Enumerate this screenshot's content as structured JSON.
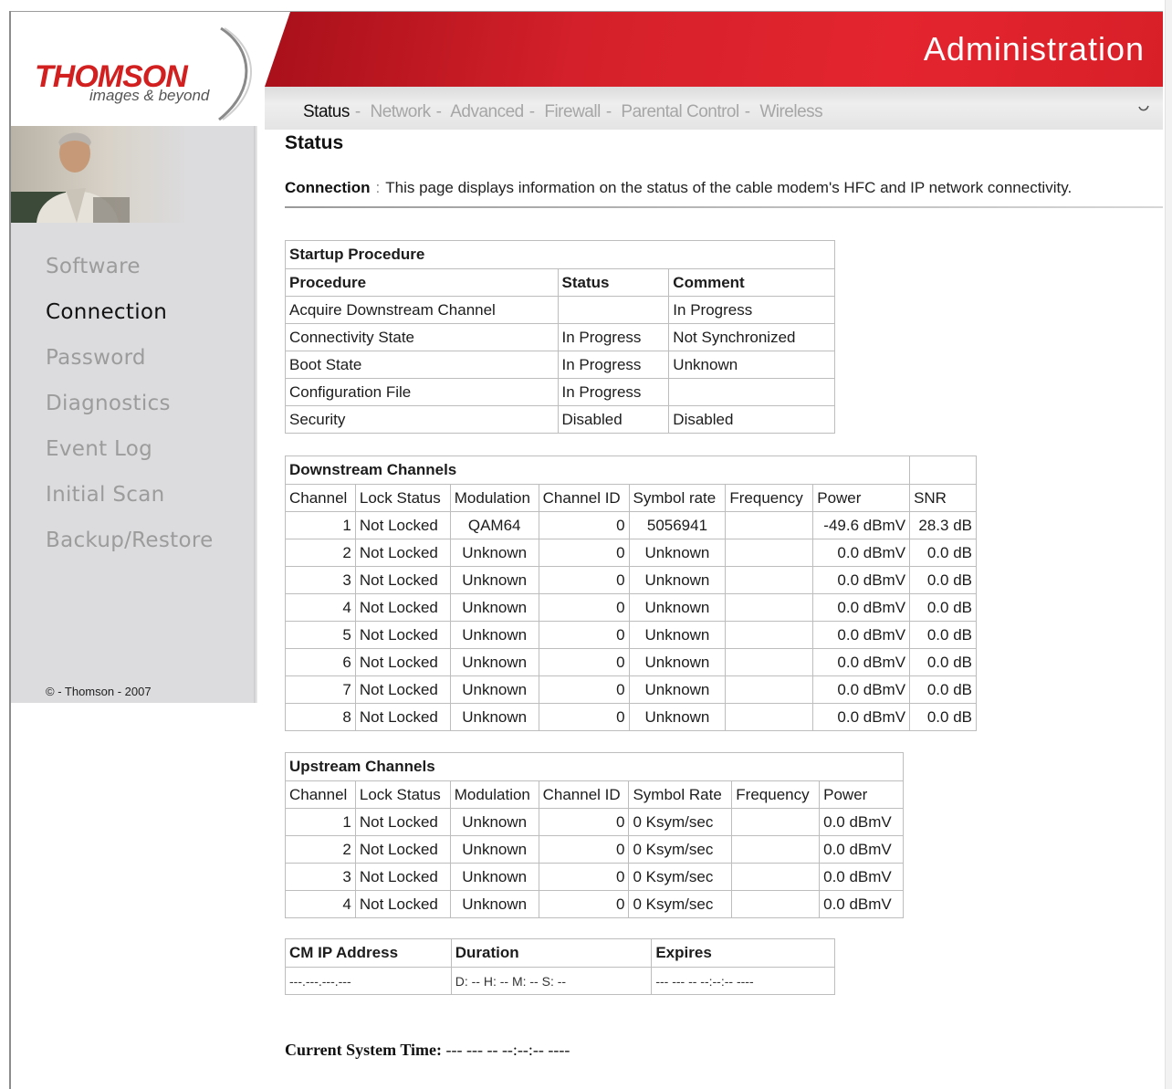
{
  "branding": {
    "logo_name": "THOMSON",
    "logo_tagline": "images & beyond",
    "banner_title": "Administration"
  },
  "top_nav": {
    "items": [
      "Status",
      "Network",
      "Advanced",
      "Firewall",
      "Parental Control",
      "Wireless"
    ],
    "active": "Status",
    "separator": "-"
  },
  "sidebar": {
    "items": [
      "Software",
      "Connection",
      "Password",
      "Diagnostics",
      "Event Log",
      "Initial Scan",
      "Backup/Restore"
    ],
    "active": "Connection",
    "copyright": "© - Thomson - 2007"
  },
  "page": {
    "heading": "Status",
    "section_label": "Connection",
    "colon": ":",
    "description": "This page displays information on the status of the cable modem's HFC and IP network connectivity."
  },
  "startup": {
    "title": "Startup Procedure",
    "headers": [
      "Procedure",
      "Status",
      "Comment"
    ],
    "rows": [
      [
        "Acquire Downstream Channel",
        "",
        "In Progress"
      ],
      [
        "Connectivity State",
        "In Progress",
        "Not Synchronized"
      ],
      [
        "Boot State",
        "In Progress",
        "Unknown"
      ],
      [
        "Configuration File",
        "In Progress",
        ""
      ],
      [
        "Security",
        "Disabled",
        "Disabled"
      ]
    ]
  },
  "downstream": {
    "title": "Downstream Channels",
    "headers": [
      "Channel",
      "Lock Status",
      "Modulation",
      "Channel ID",
      "Symbol rate",
      "Frequency",
      "Power",
      "SNR"
    ],
    "rows": [
      [
        "1",
        "Not Locked",
        "QAM64",
        "0",
        "5056941",
        "",
        "-49.6 dBmV",
        "28.3 dB"
      ],
      [
        "2",
        "Not Locked",
        "Unknown",
        "0",
        "Unknown",
        "",
        "0.0 dBmV",
        "0.0 dB"
      ],
      [
        "3",
        "Not Locked",
        "Unknown",
        "0",
        "Unknown",
        "",
        "0.0 dBmV",
        "0.0 dB"
      ],
      [
        "4",
        "Not Locked",
        "Unknown",
        "0",
        "Unknown",
        "",
        "0.0 dBmV",
        "0.0 dB"
      ],
      [
        "5",
        "Not Locked",
        "Unknown",
        "0",
        "Unknown",
        "",
        "0.0 dBmV",
        "0.0 dB"
      ],
      [
        "6",
        "Not Locked",
        "Unknown",
        "0",
        "Unknown",
        "",
        "0.0 dBmV",
        "0.0 dB"
      ],
      [
        "7",
        "Not Locked",
        "Unknown",
        "0",
        "Unknown",
        "",
        "0.0 dBmV",
        "0.0 dB"
      ],
      [
        "8",
        "Not Locked",
        "Unknown",
        "0",
        "Unknown",
        "",
        "0.0 dBmV",
        "0.0 dB"
      ]
    ]
  },
  "upstream": {
    "title": "Upstream Channels",
    "headers": [
      "Channel",
      "Lock Status",
      "Modulation",
      "Channel ID",
      "Symbol Rate",
      "Frequency",
      "Power"
    ],
    "rows": [
      [
        "1",
        "Not Locked",
        "Unknown",
        "0",
        "0 Ksym/sec",
        "",
        "0.0 dBmV"
      ],
      [
        "2",
        "Not Locked",
        "Unknown",
        "0",
        "0 Ksym/sec",
        "",
        "0.0 dBmV"
      ],
      [
        "3",
        "Not Locked",
        "Unknown",
        "0",
        "0 Ksym/sec",
        "",
        "0.0 dBmV"
      ],
      [
        "4",
        "Not Locked",
        "Unknown",
        "0",
        "0 Ksym/sec",
        "",
        "0.0 dBmV"
      ]
    ]
  },
  "ip_info": {
    "headers": [
      "CM IP Address",
      "Duration",
      "Expires"
    ],
    "values": [
      "---.---.---.---",
      "D: -- H: -- M: -- S: --",
      "--- --- -- --:--:-- ----"
    ]
  },
  "system_time": {
    "label": "Current System Time:",
    "value": "--- --- -- --:--:-- ----"
  },
  "colors": {
    "banner_red": "#d4202a",
    "logo_red": "#d21f1f",
    "sidebar_bg": "#dcdcdf",
    "nav_inactive": "#a6a6a6"
  }
}
